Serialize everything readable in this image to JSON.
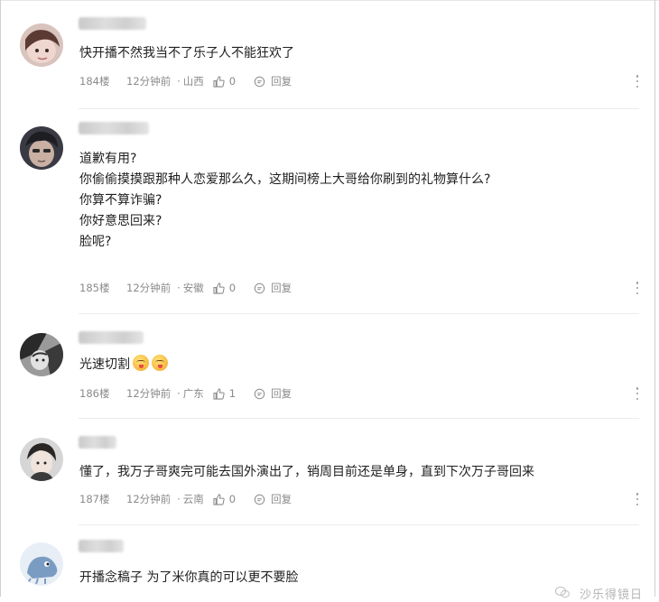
{
  "comments": [
    {
      "floor": "184楼",
      "time": "12分钟前",
      "location": "山西",
      "likes": "0",
      "reply_label": "回复",
      "lines": [
        "快开播不然我当不了乐子人不能狂欢了"
      ],
      "avatar_icon": "user-avatar"
    },
    {
      "floor": "185楼",
      "time": "12分钟前",
      "location": "安徽",
      "likes": "0",
      "reply_label": "回复",
      "lines": [
        "道歉有用?",
        "你偷偷摸摸跟那种人恋爱那么久，这期间榜上大哥给你刷到的礼物算什么?",
        "你算不算诈骗?",
        "你好意思回来?",
        "脸呢?"
      ],
      "avatar_icon": "user-avatar"
    },
    {
      "floor": "186楼",
      "time": "12分钟前",
      "location": "广东",
      "likes": "1",
      "reply_label": "回复",
      "lines": [
        "光速切割"
      ],
      "emoji": [
        "yum-emoji",
        "yum-emoji"
      ],
      "avatar_icon": "user-avatar"
    },
    {
      "floor": "187楼",
      "time": "12分钟前",
      "location": "云南",
      "likes": "0",
      "reply_label": "回复",
      "lines": [
        "懂了，我万子哥爽完可能去国外演出了，销周目前还是单身，直到下次万子哥回来"
      ],
      "avatar_icon": "user-avatar"
    },
    {
      "lines": [
        "开播念稿子 为了米你真的可以更不要脸"
      ],
      "avatar_icon": "user-avatar"
    }
  ],
  "watermark": {
    "text": "沙乐得镜日",
    "icon": "wechat-icon"
  },
  "colors": {
    "meta": "#8a8a8a",
    "separator": "#ececec",
    "text": "#1f1f1f"
  }
}
